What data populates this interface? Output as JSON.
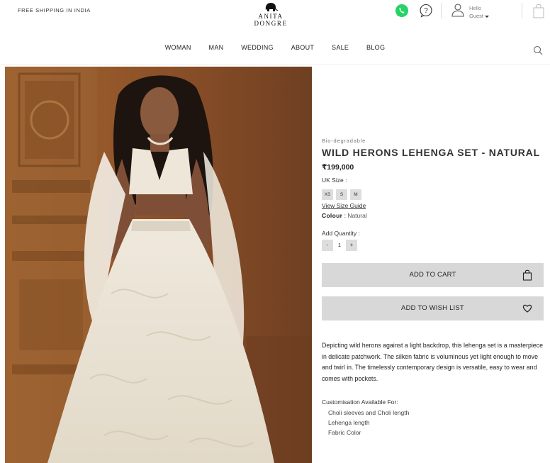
{
  "header": {
    "shipping": "FREE SHIPPING IN INDIA",
    "logo_text": "ANITA DONGRE",
    "hello": "Hello",
    "guest": "Guest",
    "icons": [
      "elephant-logo-icon",
      "whatsapp-icon",
      "help-icon",
      "user-icon",
      "bag-icon",
      "search-icon"
    ]
  },
  "nav": {
    "items": [
      "WOMAN",
      "MAN",
      "WEDDING",
      "ABOUT",
      "SALE",
      "BLOG"
    ]
  },
  "product": {
    "tag": "Bio-degradable",
    "title": "WILD HERONS LEHENGA SET - NATURAL",
    "price": "₹199,000",
    "size_label": "UK Size :",
    "sizes": [
      "XS",
      "S",
      "M"
    ],
    "size_guide": "View Size Guide",
    "colour_label": "Colour",
    "colour_sep": ":",
    "colour_value": "Natural",
    "qty_label": "Add Quantity :",
    "qty_minus": "-",
    "qty_value": "1",
    "qty_plus": "+",
    "add_to_cart": "ADD TO CART",
    "add_to_wishlist": "ADD TO WISH LIST",
    "description": "Depicting wild herons against a light backdrop, this lehenga set is a masterpiece in delicate patchwork. The silken fabric is voluminous yet light enough to move and twirl in. The timelessly contemporary design is versatile, easy to wear and comes with pockets.",
    "customisation_label": "Customisation Available For:",
    "customisation_items": [
      "Choli sleeves and Choli length",
      "Lehenga length",
      "Fabric Color"
    ]
  },
  "colors": {
    "whatsapp": "#25D366",
    "button_bg": "#d8d8d8",
    "chip_bg": "#dddddd"
  }
}
